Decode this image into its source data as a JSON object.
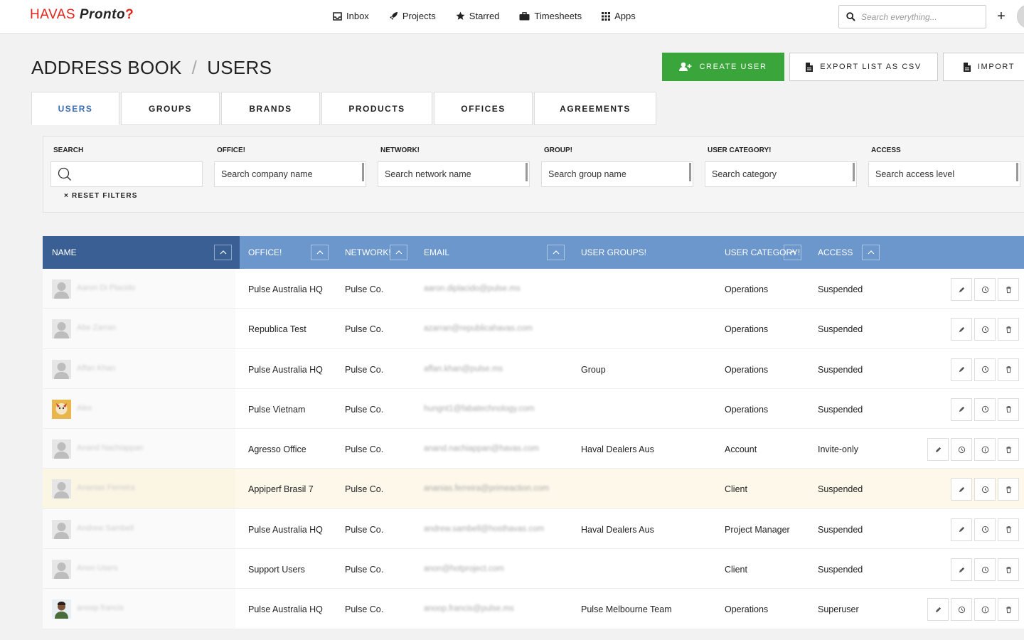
{
  "brand": {
    "part1": "HAVAS",
    "part2": "Pronto",
    "part3": "?"
  },
  "nav": [
    {
      "label": "Inbox",
      "icon": "inbox-icon"
    },
    {
      "label": "Projects",
      "icon": "rocket-icon"
    },
    {
      "label": "Starred",
      "icon": "star-icon"
    },
    {
      "label": "Timesheets",
      "icon": "briefcase-icon"
    },
    {
      "label": "Apps",
      "icon": "apps-grid-icon"
    }
  ],
  "global_search": {
    "placeholder": "Search everything..."
  },
  "header": {
    "section": "ADDRESS BOOK",
    "page": "USERS"
  },
  "actions": {
    "create": "CREATE USER",
    "export": "EXPORT LIST AS CSV",
    "import": "IMPORT"
  },
  "tabs": [
    "USERS",
    "GROUPS",
    "BRANDS",
    "PRODUCTS",
    "OFFICES",
    "AGREEMENTS"
  ],
  "filters": {
    "search_label": "SEARCH",
    "office_label": "OFFICE!",
    "office_placeholder": "Search company name",
    "network_label": "NETWORK!",
    "network_placeholder": "Search network name",
    "group_label": "GROUP!",
    "group_placeholder": "Search group name",
    "category_label": "USER CATEGORY!",
    "category_placeholder": "Search category",
    "access_label": "ACCESS",
    "access_placeholder": "Search access level",
    "reset": "× RESET FILTERS"
  },
  "columns": {
    "name": "NAME",
    "office": "OFFICE!",
    "network": "NETWORK!",
    "email": "EMAIL",
    "groups": "USER GROUPS!",
    "category": "USER CATEGORY!",
    "access": "ACCESS"
  },
  "rows": [
    {
      "name": "Aaron Di Placido",
      "office": "Pulse Australia HQ",
      "network": "Pulse Co.",
      "email": "aaron.diplacido@pulse.ms",
      "groups": "",
      "category": "Operations",
      "access": "Suspended",
      "avatar": "placeholder",
      "extra_action": false,
      "highlight": false
    },
    {
      "name": "Abe Zarran",
      "office": "Republica Test",
      "network": "Pulse Co.",
      "email": "azarran@republicahavas.com",
      "groups": "",
      "category": "Operations",
      "access": "Suspended",
      "avatar": "placeholder",
      "extra_action": false,
      "highlight": false
    },
    {
      "name": "Affan Khan",
      "office": "Pulse Australia HQ",
      "network": "Pulse Co.",
      "email": "affan.khan@pulse.ms",
      "groups": "Group",
      "category": "Operations",
      "access": "Suspended",
      "avatar": "placeholder",
      "extra_action": false,
      "highlight": false
    },
    {
      "name": "Alex",
      "office": "Pulse Vietnam",
      "network": "Pulse Co.",
      "email": "hungnt1@fabatechnology.com",
      "groups": "",
      "category": "Operations",
      "access": "Suspended",
      "avatar": "photo",
      "extra_action": false,
      "highlight": false
    },
    {
      "name": "Anand Nachiappan",
      "office": "Agresso Office",
      "network": "Pulse Co.",
      "email": "anand.nachiappan@havas.com",
      "groups": "Haval Dealers Aus",
      "category": "Account",
      "access": "Invite-only",
      "avatar": "placeholder",
      "extra_action": true,
      "highlight": false
    },
    {
      "name": "Ananias Ferreira",
      "office": "Appiperf Brasil 7",
      "network": "Pulse Co.",
      "email": "ananias.ferreira@primeaction.com",
      "groups": "",
      "category": "Client",
      "access": "Suspended",
      "avatar": "placeholder",
      "extra_action": false,
      "highlight": true
    },
    {
      "name": "Andrew Sambell",
      "office": "Pulse Australia HQ",
      "network": "Pulse Co.",
      "email": "andrew.sambell@hosthavas.com",
      "groups": "Haval Dealers Aus",
      "category": "Project Manager",
      "access": "Suspended",
      "avatar": "placeholder",
      "extra_action": false,
      "highlight": false
    },
    {
      "name": "Anon Users",
      "office": "Support Users",
      "network": "Pulse Co.",
      "email": "anon@hotproject.com",
      "groups": "",
      "category": "Client",
      "access": "Suspended",
      "avatar": "placeholder",
      "extra_action": false,
      "highlight": false
    },
    {
      "name": "anoop francis",
      "office": "Pulse Australia HQ",
      "network": "Pulse Co.",
      "email": "anoop.francis@pulse.ms",
      "groups": "Pulse Melbourne Team",
      "category": "Operations",
      "access": "Superuser",
      "avatar": "photo2",
      "extra_action": true,
      "highlight": false
    }
  ],
  "colors": {
    "green": "#3aa53a",
    "header_blue": "#6b97cc",
    "header_dark": "#3a5f94",
    "active_tab": "#3a6db4",
    "brand_red": "#e2231a"
  }
}
